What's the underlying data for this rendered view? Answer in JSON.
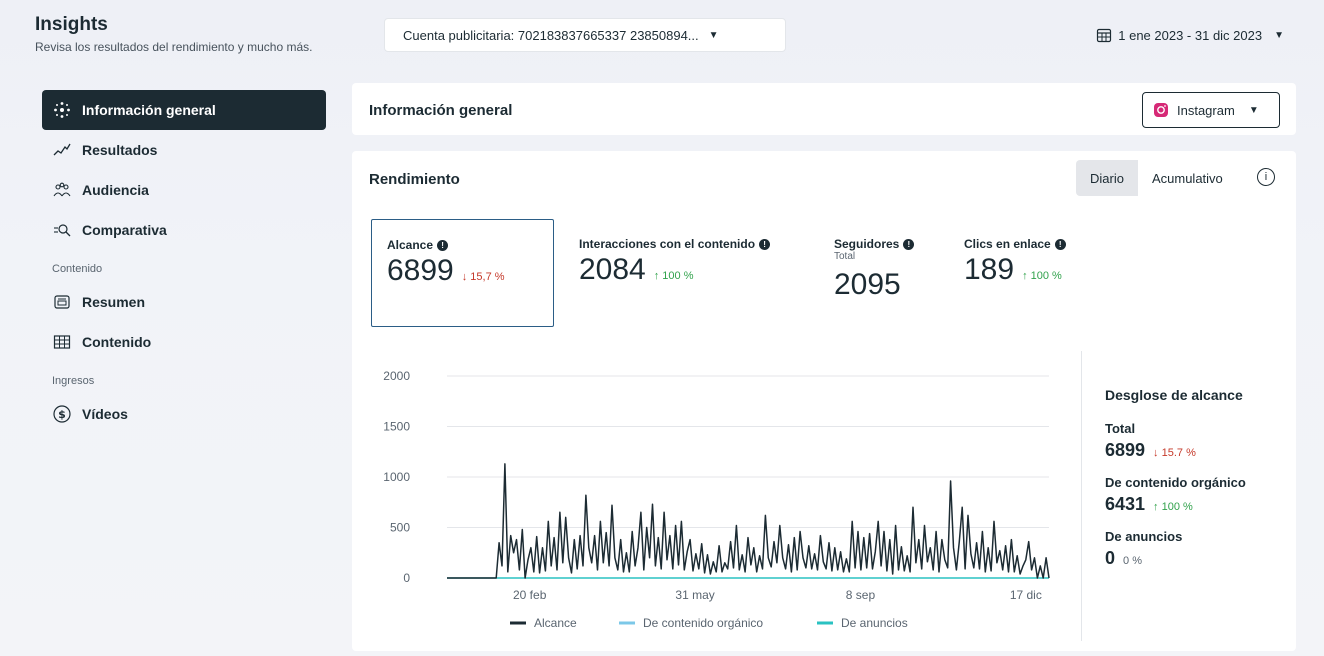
{
  "header": {
    "title": "Insights",
    "subtitle": "Revisa los resultados del rendimiento y mucho más.",
    "account_select": "Cuenta publicitaria: 702183837665337 23850894...",
    "date_range": "1 ene 2023 - 31 dic 2023"
  },
  "sidebar": {
    "items": [
      {
        "label": "Información general"
      },
      {
        "label": "Resultados"
      },
      {
        "label": "Audiencia"
      },
      {
        "label": "Comparativa"
      }
    ],
    "section_content": "Contenido",
    "content_items": [
      {
        "label": "Resumen"
      },
      {
        "label": "Contenido"
      }
    ],
    "section_income": "Ingresos",
    "income_items": [
      {
        "label": "Vídeos"
      }
    ]
  },
  "overview": {
    "title": "Información general",
    "platform": "Instagram"
  },
  "performance": {
    "title": "Rendimiento",
    "toggle_daily": "Diario",
    "toggle_cumulative": "Acumulativo",
    "metrics": [
      {
        "label": "Alcance",
        "value": "6899",
        "delta": "↓ 15,7 %"
      },
      {
        "label": "Interacciones con el contenido",
        "value": "2084",
        "delta": "↑ 100 %"
      },
      {
        "label": "Seguidores",
        "sub": "Total",
        "value": "2095"
      },
      {
        "label": "Clics en enlace",
        "value": "189",
        "delta": "↑ 100 %"
      }
    ],
    "breakdown": {
      "title": "Desglose de alcance",
      "total_label": "Total",
      "total_value": "6899",
      "total_delta": "↓ 15.7 %",
      "organic_label": "De contenido orgánico",
      "organic_value": "6431",
      "organic_delta": "↑ 100 %",
      "ads_label": "De anuncios",
      "ads_value": "0",
      "ads_delta": "0 %"
    }
  },
  "colors": {
    "dark": "#1c2b33",
    "organic": "#7cc8e8",
    "ads": "#2ac2c2",
    "down": "#c5392a",
    "up": "#31a24c"
  },
  "chart_data": {
    "type": "line",
    "yticks": [
      "0",
      "500",
      "1000",
      "1500",
      "2000"
    ],
    "ylim": [
      0,
      2000
    ],
    "xticks": [
      {
        "label": "20 feb",
        "day": 50
      },
      {
        "label": "31 may",
        "day": 150
      },
      {
        "label": "8 sep",
        "day": 250
      },
      {
        "label": "17 dic",
        "day": 350
      }
    ],
    "xlim": [
      0,
      364
    ],
    "series": [
      {
        "name": "Alcance",
        "color": "#1c2b33",
        "values": [
          0,
          0,
          0,
          0,
          0,
          0,
          0,
          0,
          0,
          0,
          0,
          0,
          0,
          0,
          0,
          0,
          0,
          0,
          350,
          120,
          1130,
          60,
          420,
          250,
          380,
          80,
          480,
          0,
          180,
          300,
          60,
          410,
          50,
          300,
          70,
          560,
          120,
          400,
          80,
          650,
          150,
          600,
          200,
          50,
          380,
          90,
          420,
          120,
          820,
          300,
          150,
          420,
          80,
          560,
          150,
          450,
          120,
          720,
          200,
          80,
          380,
          60,
          250,
          60,
          460,
          120,
          300,
          650,
          80,
          500,
          200,
          730,
          120,
          400,
          90,
          650,
          180,
          420,
          90,
          520,
          130,
          560,
          80,
          260,
          380,
          70,
          240,
          90,
          340,
          50,
          230,
          40,
          160,
          60,
          320,
          60,
          150,
          90,
          360,
          100,
          520,
          80,
          230,
          60,
          400,
          130,
          300,
          60,
          220,
          90,
          620,
          200,
          110,
          360,
          150,
          520,
          200,
          90,
          330,
          60,
          400,
          80,
          460,
          200,
          100,
          320,
          90,
          240,
          80,
          420,
          160,
          90,
          350,
          70,
          300,
          80,
          260,
          60,
          190,
          60,
          560,
          100,
          460,
          80,
          400,
          100,
          440,
          90,
          260,
          560,
          120,
          460,
          70,
          380,
          40,
          520,
          80,
          310,
          70,
          220,
          60,
          700,
          150,
          380,
          90,
          520,
          160,
          300,
          80,
          460,
          60,
          380,
          180,
          100,
          960,
          300,
          80,
          360,
          700,
          90,
          620,
          240,
          100,
          350,
          90,
          460,
          60,
          300,
          70,
          560,
          150,
          270,
          80,
          320,
          60,
          380,
          60,
          220,
          40,
          120,
          180,
          360,
          80,
          200,
          0,
          120,
          0,
          200,
          0
        ]
      },
      {
        "name": "De contenido orgánico",
        "color": "#7cc8e8",
        "values": []
      },
      {
        "name": "De anuncios",
        "color": "#2ac2c2",
        "values": []
      }
    ]
  }
}
